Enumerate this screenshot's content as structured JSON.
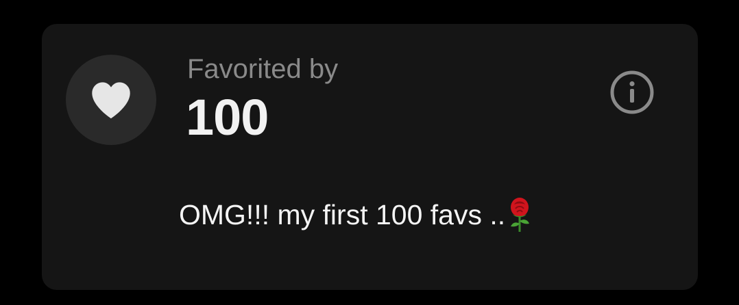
{
  "card": {
    "label": "Favorited by",
    "count": "100",
    "message": "OMG!!! my first 100 favs ..",
    "icons": {
      "heart": "heart-icon",
      "info": "info-icon",
      "rose": "rose-emoji"
    }
  },
  "colors": {
    "background": "#000000",
    "card": "#151515",
    "circle": "#2a2a2a",
    "heart": "#e6e6e6",
    "label": "#8a8a8a",
    "count": "#f2f2f2",
    "info": "#8a8a8a",
    "message": "#f4f4f4"
  }
}
